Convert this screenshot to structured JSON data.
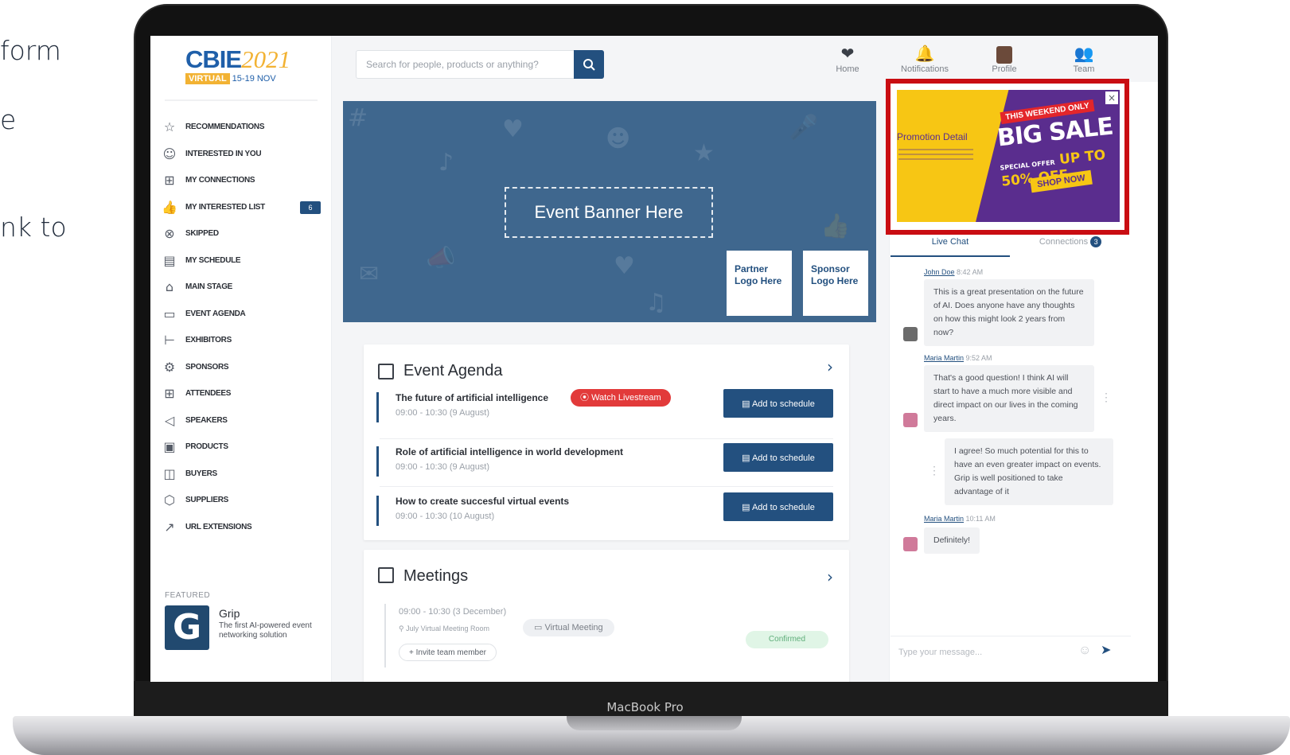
{
  "side_text": [
    "form",
    "e",
    "nk to"
  ],
  "device_label": "MacBook Pro",
  "brand": {
    "name": "CBIE",
    "year": "2021",
    "virtual": "VIRTUAL",
    "dates": "15-19 NOV"
  },
  "search": {
    "placeholder": "Search for people, products or anything?"
  },
  "topnav": [
    {
      "label": "Home",
      "icon": "heart-icon"
    },
    {
      "label": "Notifications",
      "icon": "bell-icon"
    },
    {
      "label": "Profile",
      "icon": "profile-icon"
    },
    {
      "label": "Team",
      "icon": "team-icon"
    }
  ],
  "sidebar": {
    "items": [
      {
        "label": "RECOMMENDATIONS",
        "icon": "star-icon",
        "badge": ""
      },
      {
        "label": "INTERESTED IN YOU",
        "icon": "smiley-icon",
        "badge": ""
      },
      {
        "label": "MY CONNECTIONS",
        "icon": "connections-icon",
        "badge": ""
      },
      {
        "label": "MY INTERESTED LIST",
        "icon": "thumbs-up-icon",
        "badge": "6"
      },
      {
        "label": "SKIPPED",
        "icon": "skip-icon",
        "badge": ""
      },
      {
        "label": "MY SCHEDULE",
        "icon": "schedule-icon",
        "badge": ""
      },
      {
        "label": "MAIN STAGE",
        "icon": "stage-icon",
        "badge": ""
      },
      {
        "label": "EVENT AGENDA",
        "icon": "calendar-icon",
        "badge": ""
      },
      {
        "label": "EXHIBITORS",
        "icon": "exhibitors-icon",
        "badge": ""
      },
      {
        "label": "SPONSORS",
        "icon": "sponsors-icon",
        "badge": ""
      },
      {
        "label": "ATTENDEES",
        "icon": "attendees-icon",
        "badge": ""
      },
      {
        "label": "SPEAKERS",
        "icon": "megaphone-icon",
        "badge": ""
      },
      {
        "label": "PRODUCTS",
        "icon": "products-icon",
        "badge": ""
      },
      {
        "label": "BUYERS",
        "icon": "buyers-icon",
        "badge": ""
      },
      {
        "label": "SUPPLIERS",
        "icon": "suppliers-icon",
        "badge": ""
      },
      {
        "label": "URL EXTENSIONS",
        "icon": "external-link-icon",
        "badge": ""
      }
    ],
    "featured": {
      "label": "FEATURED",
      "name": "Grip",
      "logo_letter": "G",
      "description": "The first AI-powered event networking solution"
    }
  },
  "banner": {
    "title": "Event Banner Here",
    "partner": "Partner Logo Here",
    "sponsor": "Sponsor Logo Here"
  },
  "agenda": {
    "title": "Event Agenda",
    "items": [
      {
        "title": "The future of artificial intelligence",
        "time": "09:00 - 10:30 (9 August)",
        "button": "Add to schedule",
        "live": "Watch Livestream"
      },
      {
        "title": "Role of artificial intelligence in world development",
        "time": "09:00 - 10:30 (9 August)",
        "button": "Add to schedule",
        "live": ""
      },
      {
        "title": "How to create succesful virtual events",
        "time": "09:00 - 10:30 (10 August)",
        "button": "Add to schedule",
        "live": ""
      }
    ]
  },
  "meetings": {
    "title": "Meetings",
    "time": "09:00 - 10:30 (3 December)",
    "room": "July Virtual Meeting Room",
    "type": "Virtual Meeting",
    "status": "Confirmed",
    "invite": "+ Invite team member"
  },
  "promo": {
    "detail": "Promotion Detail",
    "tag": "THIS WEEKEND ONLY",
    "headline": "BIG SALE",
    "offer": "UP TO 50% OFF",
    "special": "SPECIAL OFFER",
    "cta": "SHOP NOW",
    "close": "×"
  },
  "chat": {
    "tab_live": "Live Chat",
    "tab_connections": "Connections",
    "connections_count": "3",
    "messages": [
      {
        "author": "John Doe",
        "time": "8:42 AM",
        "text": "This is a great presentation on the future of AI. Does anyone have any thoughts on how this might look 2 years from now?"
      },
      {
        "author": "Maria Martin",
        "time": "9:52 AM",
        "text": "That's a good question! I think AI will start to have a much more visible and direct impact on our lives in the coming years."
      },
      {
        "author": "",
        "time": "",
        "text": "I agree! So much potential for this to have an even greater impact on events. Grip is well positioned to take advantage of it"
      },
      {
        "author": "Maria Martin",
        "time": "10:11 AM",
        "text": "Definitely!"
      }
    ],
    "input_placeholder": "Type your message..."
  },
  "colors": {
    "primary": "#23507f",
    "banner": "#3f678e",
    "live": "#e23a3a",
    "promo_yellow": "#f7c614",
    "promo_purple": "#5a2d8e",
    "highlight": "#c90d12"
  }
}
